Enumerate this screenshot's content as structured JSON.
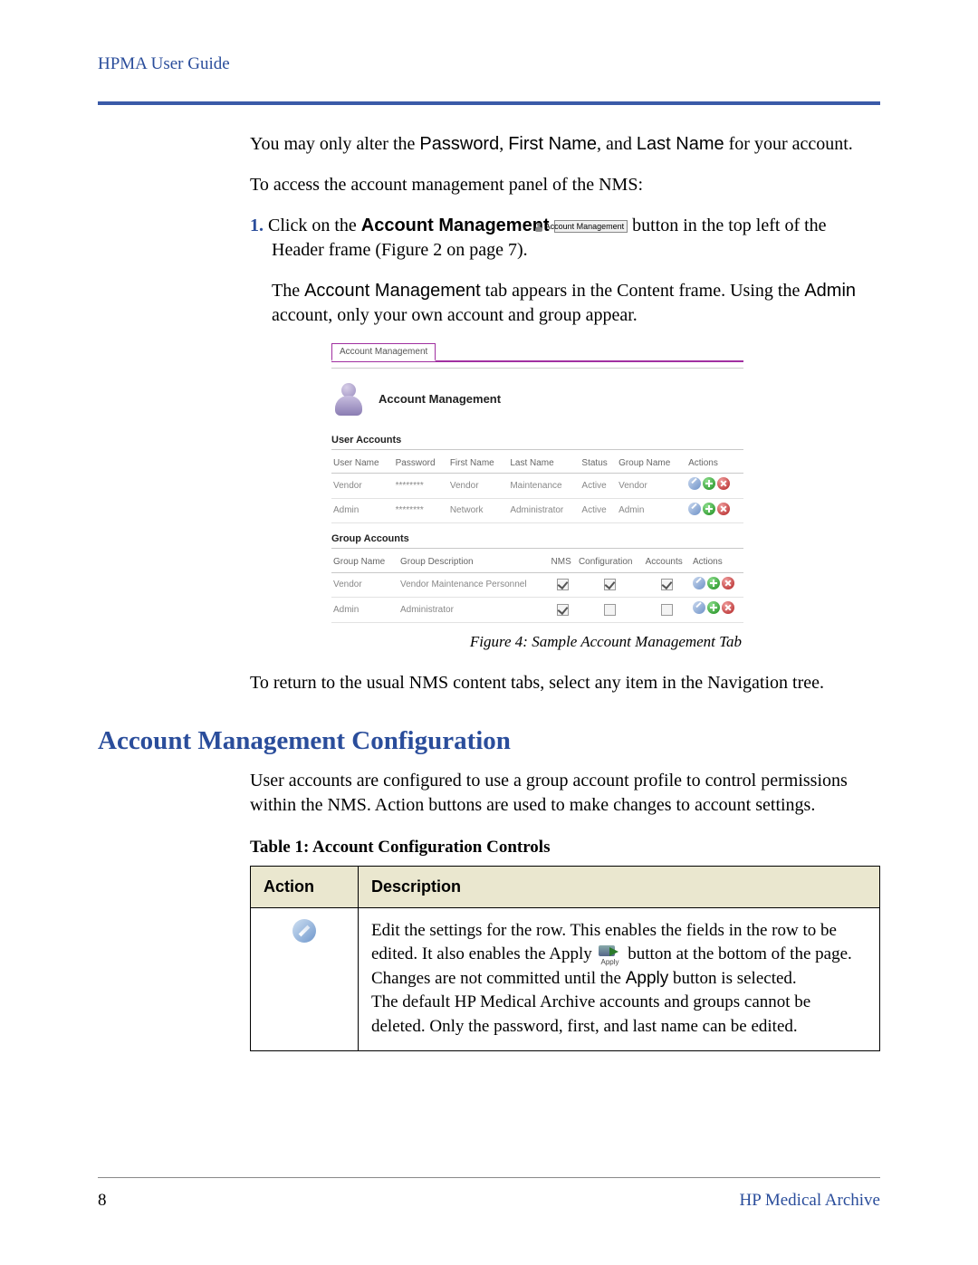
{
  "header": {
    "title": "HPMA User Guide"
  },
  "intro": {
    "p1_a": "You may only alter the ",
    "p1_pw": "Password",
    "p1_b": ", ",
    "p1_fn": "First Name",
    "p1_c": ", and ",
    "p1_ln": "Last Name",
    "p1_d": " for your account.",
    "p2": "To access the account management panel of the NMS:"
  },
  "step1": {
    "num": "1.",
    "a": "Click on the ",
    "am_bold": "Account Management",
    "btn_label": "Account Management",
    "b": " button in the top left of the Header frame (Figure 2 on page 7).",
    "c_a": "The ",
    "c_tab": "Account Management",
    "c_b": " tab appears in the Content frame. Using the ",
    "c_admin": "Admin",
    "c_c": " account, only your own account and group appear."
  },
  "figure": {
    "tab": "Account Management",
    "title": "Account Management",
    "sec_user": "User Accounts",
    "sec_group": "Group Accounts",
    "user_headers": [
      "User Name",
      "Password",
      "First Name",
      "Last Name",
      "Status",
      "Group Name",
      "Actions"
    ],
    "user_rows": [
      {
        "user": "Vendor",
        "pwd": "********",
        "first": "Vendor",
        "last": "Maintenance",
        "status": "Active",
        "group": "Vendor"
      },
      {
        "user": "Admin",
        "pwd": "********",
        "first": "Network",
        "last": "Administrator",
        "status": "Active",
        "group": "Admin"
      }
    ],
    "group_headers": [
      "Group Name",
      "Group Description",
      "NMS",
      "Configuration",
      "Accounts",
      "Actions"
    ],
    "group_rows": [
      {
        "group": "Vendor",
        "desc": "Vendor Maintenance Personnel",
        "nms": true,
        "cfg": true,
        "acct": true
      },
      {
        "group": "Admin",
        "desc": "Administrator",
        "nms": true,
        "cfg": false,
        "acct": false
      }
    ],
    "caption": "Figure 4: Sample Account Management Tab"
  },
  "after_fig": "To return to the usual NMS content tabs, select any item in the Navigation tree.",
  "section_heading": "Account Management Configuration",
  "section_body": "User accounts are configured to use a group account profile to control permissions within the NMS. Action buttons are used to make changes to account settings.",
  "table1": {
    "caption": "Table 1: Account Configuration Controls",
    "head_action": "Action",
    "head_desc": "Description",
    "row1": {
      "a": "Edit the settings for the row. This enables the fields in the row to be edited. It also enables the Apply ",
      "apply_label": "Apply",
      "b_a": " button at the bottom of the page. Changes are not committed until the ",
      "b_apply": "Apply",
      "b_b": " button is selected.",
      "c": "The default HP Medical Archive accounts and groups cannot be deleted. Only the password, first, and last name can be edited."
    }
  },
  "footer": {
    "page": "8",
    "brand": "HP Medical Archive"
  }
}
